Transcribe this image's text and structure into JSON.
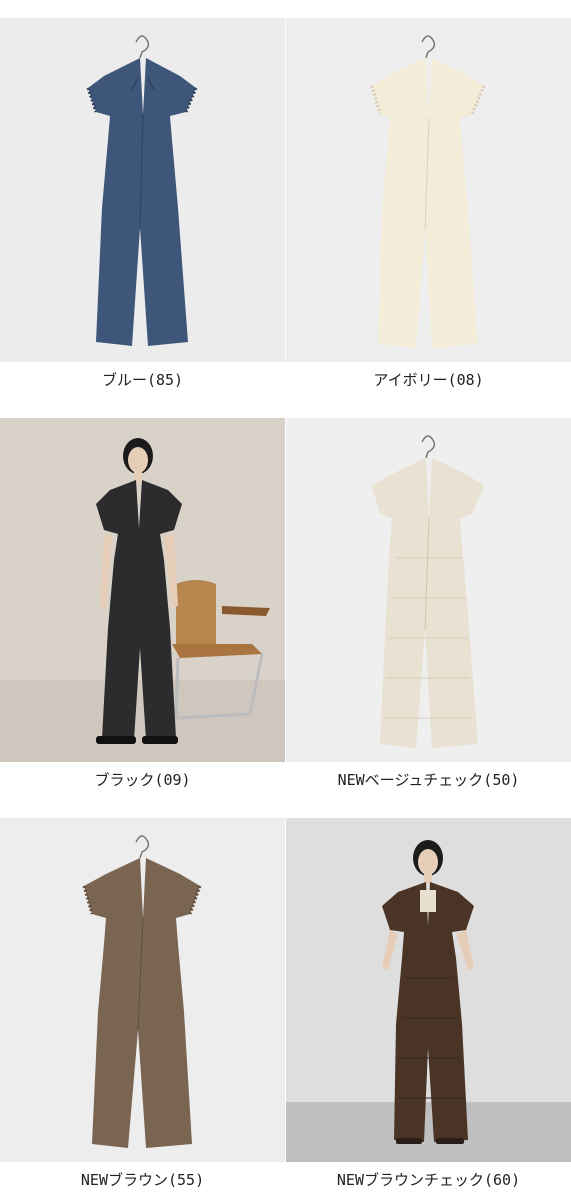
{
  "variants": [
    {
      "caption": "ブルー(85)",
      "color": "#3e5679",
      "style": "hanger",
      "bg": "#ececec"
    },
    {
      "caption": "アイボリー(08)",
      "color": "#f3ecd9",
      "style": "hanger",
      "bg": "#eeeeee"
    },
    {
      "caption": "ブラック(09)",
      "color": "#2c2c2e",
      "style": "model-chair",
      "bg": "#d9d2c8"
    },
    {
      "caption": "NEWベージュチェック(50)",
      "color": "#e9e1d2",
      "style": "hanger",
      "bg": "#efefef"
    },
    {
      "caption": "NEWブラウン(55)",
      "color": "#7a6553",
      "style": "hanger",
      "bg": "#ededed"
    },
    {
      "caption": "NEWブラウンチェック(60)",
      "color": "#4a3426",
      "style": "model",
      "bg": "#dedede"
    }
  ]
}
